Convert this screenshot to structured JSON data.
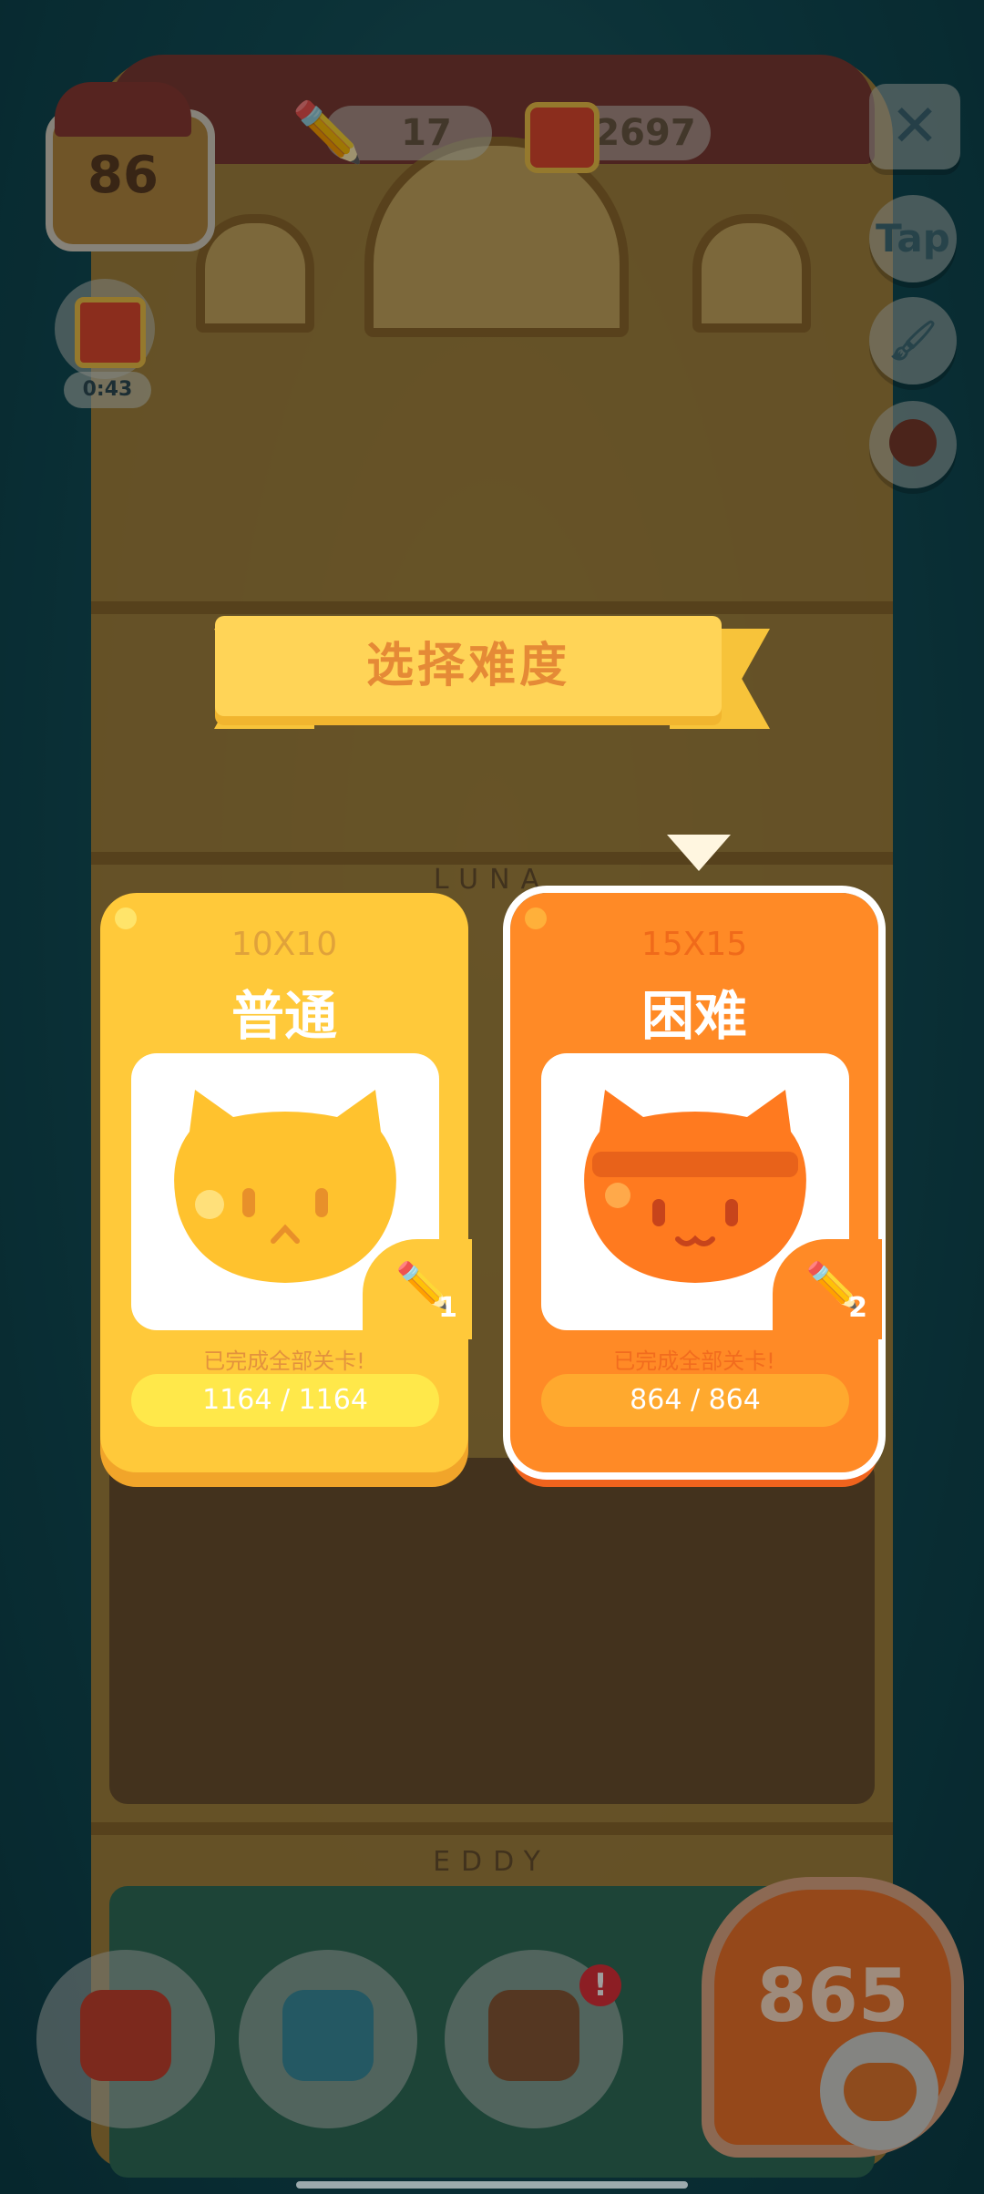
{
  "hud": {
    "level": "86",
    "pencils": "17",
    "cans": "2697",
    "gift_timer": "0:43",
    "tap_label": "Tap"
  },
  "dialog": {
    "title": "选择难度",
    "cards": [
      {
        "size": "10X10",
        "name": "普通",
        "status": "已完成全部关卡!",
        "progress": "1164 / 1164",
        "pencil_count": "1"
      },
      {
        "size": "15X15",
        "name": "困难",
        "status": "已完成全部关卡!",
        "progress": "864 / 864",
        "pencil_count": "2"
      }
    ]
  },
  "bottom": {
    "level_number": "865",
    "alert_mark": "!"
  },
  "background_labels": {
    "luna": "LUNA",
    "eddy": "EDDY"
  }
}
